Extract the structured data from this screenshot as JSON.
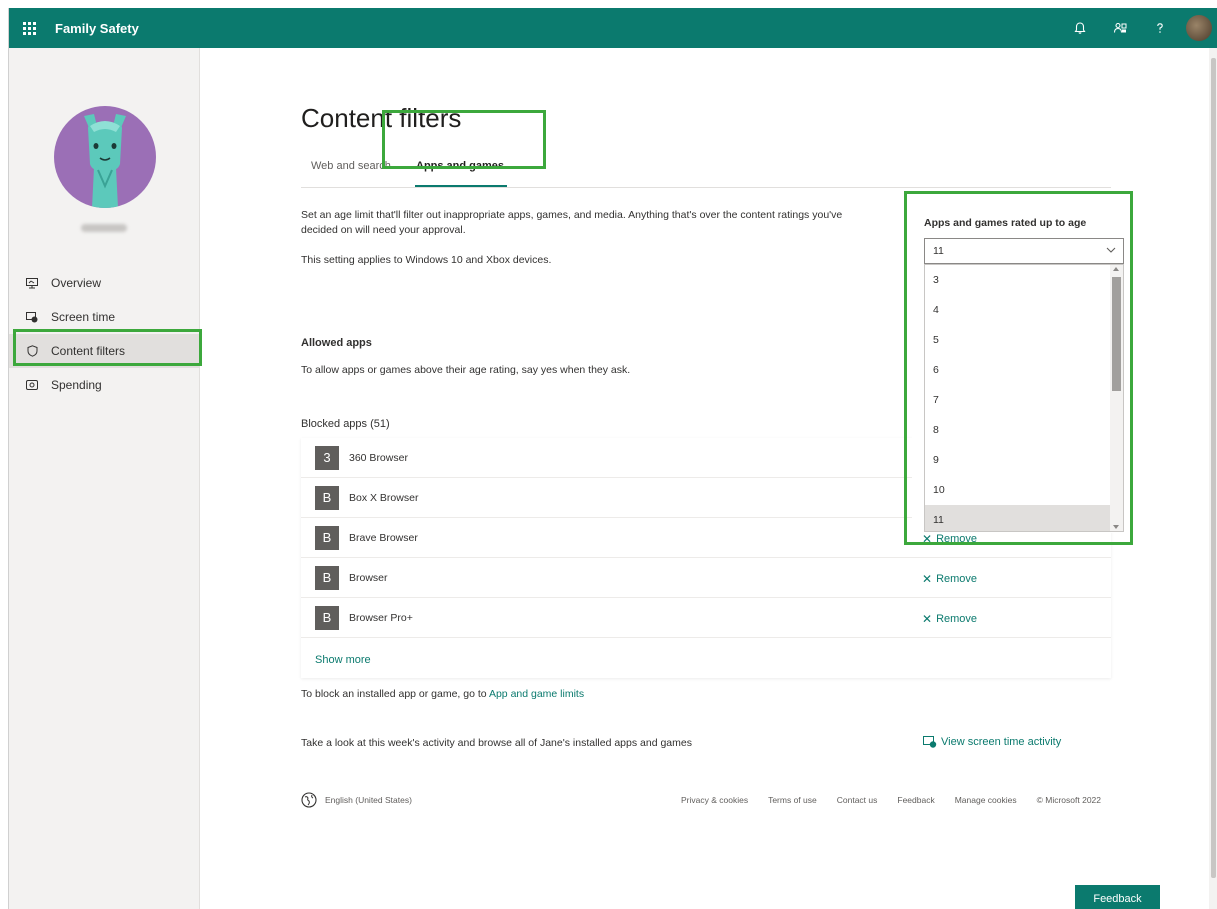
{
  "header": {
    "app_title": "Family Safety",
    "icons": [
      "waffle-icon",
      "bell-icon",
      "people-icon",
      "help-icon",
      "user-avatar"
    ]
  },
  "sidebar": {
    "items": [
      {
        "label": "Overview",
        "icon": "overview-icon"
      },
      {
        "label": "Screen time",
        "icon": "screen-time-icon"
      },
      {
        "label": "Content filters",
        "icon": "shield-icon",
        "active": true
      },
      {
        "label": "Spending",
        "icon": "spending-icon"
      }
    ]
  },
  "main": {
    "title": "Content filters",
    "tabs": [
      {
        "label": "Web and search"
      },
      {
        "label": "Apps and games",
        "active": true
      }
    ],
    "description": "Set an age limit that'll filter out inappropriate apps, games, and media. Anything that's over the content ratings you've decided on will need your approval.",
    "applies_to": "This setting applies to Windows 10 and Xbox devices.",
    "allowed": {
      "heading": "Allowed apps",
      "text": "To allow apps or games above their age rating, say yes when they ask."
    },
    "blocked": {
      "heading": "Blocked apps (51)",
      "remove_label": "Remove",
      "apps": [
        {
          "tile": "3",
          "name": "360 Browser"
        },
        {
          "tile": "B",
          "name": "Box X Browser"
        },
        {
          "tile": "B",
          "name": "Brave Browser"
        },
        {
          "tile": "B",
          "name": "Browser"
        },
        {
          "tile": "B",
          "name": "Browser Pro+"
        }
      ],
      "show_more": "Show more"
    },
    "block_installed": {
      "text": "To block an installed app or game, go to ",
      "link": "App and game limits"
    },
    "activity": {
      "text": "Take a look at this week's activity and browse all of Jane's installed apps and games",
      "link": "View screen time activity"
    },
    "age_filter": {
      "label": "Apps and games rated up to age",
      "selected": "11",
      "options": [
        "3",
        "4",
        "5",
        "6",
        "7",
        "8",
        "9",
        "10",
        "11"
      ]
    }
  },
  "footer": {
    "language": "English (United States)",
    "links": [
      "Privacy & cookies",
      "Terms of use",
      "Contact us",
      "Feedback",
      "Manage cookies",
      "© Microsoft 2022"
    ]
  },
  "feedback_button": "Feedback",
  "colors": {
    "brand": "#0b7a6e",
    "highlight": "#3ca83c"
  }
}
